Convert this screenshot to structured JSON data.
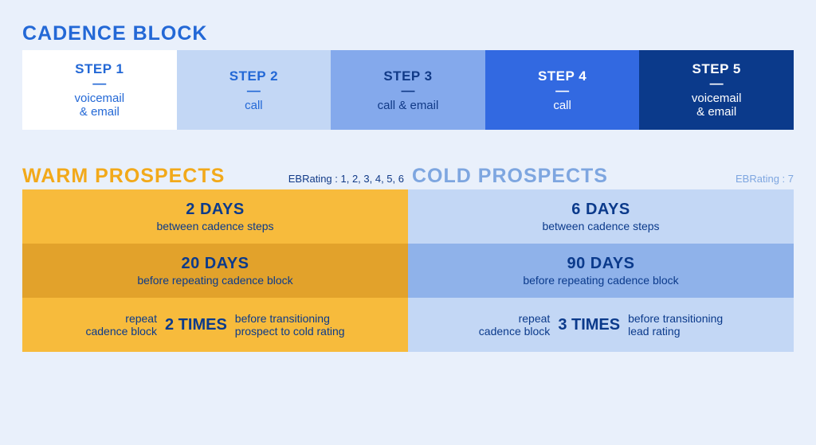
{
  "cadence": {
    "title": "CADENCE BLOCK",
    "steps": [
      {
        "title": "STEP 1",
        "desc": "voicemail\n& email"
      },
      {
        "title": "STEP 2",
        "desc": "call"
      },
      {
        "title": "STEP 3",
        "desc": "call & email"
      },
      {
        "title": "STEP 4",
        "desc": "call"
      },
      {
        "title": "STEP 5",
        "desc": "voicemail\n& email"
      }
    ]
  },
  "warm": {
    "title": "WARM PROSPECTS",
    "ebrating": "EBRating : 1, 2, 3, 4, 5, 6",
    "row1_big": "2 DAYS",
    "row1_sub": "between cadence steps",
    "row2_big": "20 DAYS",
    "row2_sub": "before repeating cadence block",
    "row3_left": "repeat\ncadence block",
    "row3_mid": "2 TIMES",
    "row3_right": "before transitioning\nprospect to cold rating"
  },
  "cold": {
    "title": "COLD PROSPECTS",
    "ebrating": "EBRating : 7",
    "row1_big": "6 DAYS",
    "row1_sub": "between cadence steps",
    "row2_big": "90 DAYS",
    "row2_sub": "before repeating cadence block",
    "row3_left": "repeat\ncadence block",
    "row3_mid": "3 TIMES",
    "row3_right": "before transitioning\nlead rating"
  }
}
